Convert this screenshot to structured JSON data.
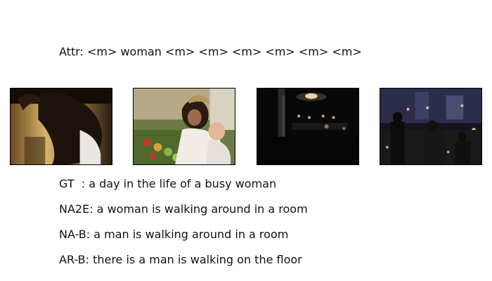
{
  "attr_line": "Attr: <m> woman <m> <m> <m> <m> <m> <m>",
  "frames": [
    {
      "name": "video-frame-1",
      "description_icon": "person-closeup-photo"
    },
    {
      "name": "video-frame-2",
      "description_icon": "woman-with-baby-market-photo"
    },
    {
      "name": "video-frame-3",
      "description_icon": "dark-ballroom-photo"
    },
    {
      "name": "video-frame-4",
      "description_icon": "dark-party-crowd-photo"
    }
  ],
  "captions": {
    "gt": "GT  : a day in the life of a busy woman",
    "na2e": "NA2E: a woman is walking around in a room",
    "nab": "NA-B: a man is walking around in a room",
    "arb": "AR-B: there is a man is walking on the floor"
  }
}
